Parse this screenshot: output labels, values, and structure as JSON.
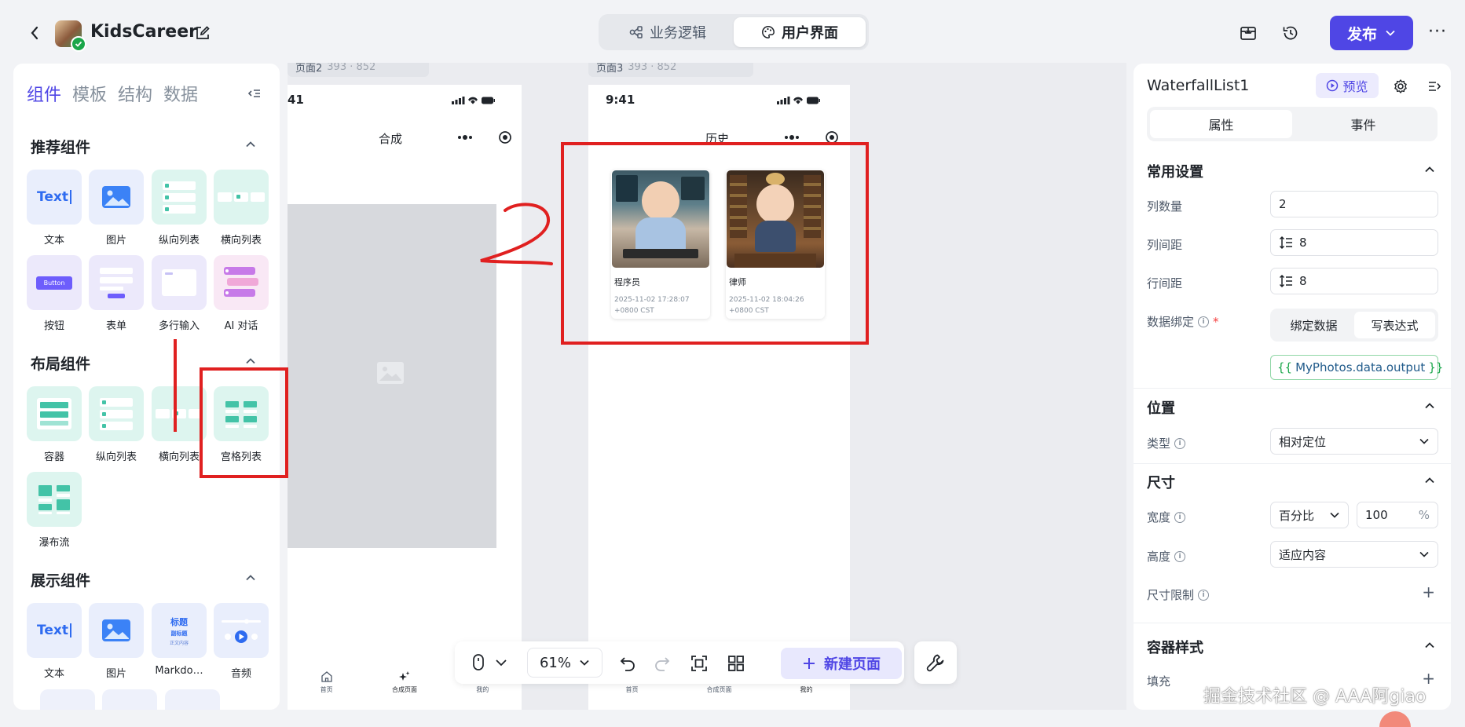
{
  "header": {
    "app_name": "KidsCareer",
    "modes": [
      "业务逻辑",
      "用户界面"
    ],
    "active_mode": "用户界面",
    "publish_label": "发布",
    "more_label": "···"
  },
  "left_panel": {
    "tabs": [
      "组件",
      "模板",
      "结构",
      "数据"
    ],
    "active_tab": "组件",
    "sections": [
      {
        "title": "推荐组件",
        "items": [
          "文本",
          "图片",
          "纵向列表",
          "横向列表",
          "按钮",
          "表单",
          "多行输入",
          "AI 对话"
        ]
      },
      {
        "title": "布局组件",
        "items": [
          "容器",
          "纵向列表",
          "横向列表",
          "宫格列表",
          "瀑布流"
        ]
      },
      {
        "title": "展示组件",
        "items": [
          "文本",
          "图片",
          "Markdo…",
          "音频"
        ]
      }
    ],
    "tile_texts": {
      "text": "Text",
      "button": "Button",
      "title": "标题",
      "subtitle": "副标题",
      "body": "正文内容"
    }
  },
  "canvas": {
    "page_left": {
      "tag": "页面2",
      "tag_size": "393 · 852",
      "time": "41",
      "title": "合成",
      "tabbar": [
        "首页",
        "合成页面",
        "我的"
      ]
    },
    "page_right": {
      "tag": "页面3",
      "tag_size": "393 · 852",
      "time": "9:41",
      "title": "历史",
      "cards": [
        {
          "title": "程序员",
          "time": "2025-11-02 17:28:07",
          "tz": "+0800 CST"
        },
        {
          "title": "律师",
          "time": "2025-11-02 18:04:26",
          "tz": "+0800 CST"
        }
      ],
      "tabbar": [
        "首页",
        "合成页面",
        "我的"
      ]
    },
    "annotation_number": "2",
    "annotation_color": "#e02020"
  },
  "toolbar": {
    "zoom": "61%",
    "new_page_label": "新建页面"
  },
  "right_panel": {
    "component_name": "WaterfallList1",
    "preview_label": "预览",
    "tabs": [
      "属性",
      "事件"
    ],
    "active_tab": "属性",
    "common": {
      "title": "常用设置",
      "columns_label": "列数量",
      "columns_value": "2",
      "col_gap_label": "列间距",
      "col_gap_value": "8",
      "row_gap_label": "行间距",
      "row_gap_value": "8",
      "binding_label": "数据绑定",
      "binding_options": [
        "绑定数据",
        "写表达式"
      ],
      "binding_active": "写表达式",
      "expression_open": "{{",
      "expression_body": "MyPhotos.data.output",
      "expression_close": "}}"
    },
    "position": {
      "title": "位置",
      "type_label": "类型",
      "type_value": "相对定位"
    },
    "size": {
      "title": "尺寸",
      "width_label": "宽度",
      "width_unit": "百分比",
      "width_value": "100",
      "width_suffix": "%",
      "height_label": "高度",
      "height_value": "适应内容",
      "limit_label": "尺寸限制"
    },
    "container_style": {
      "title": "容器样式",
      "fill_label": "填充"
    }
  },
  "watermark": "掘金技术社区 @ AAA阿giao",
  "colors": {
    "accent": "#4f46e5",
    "annotation": "#e02020"
  }
}
